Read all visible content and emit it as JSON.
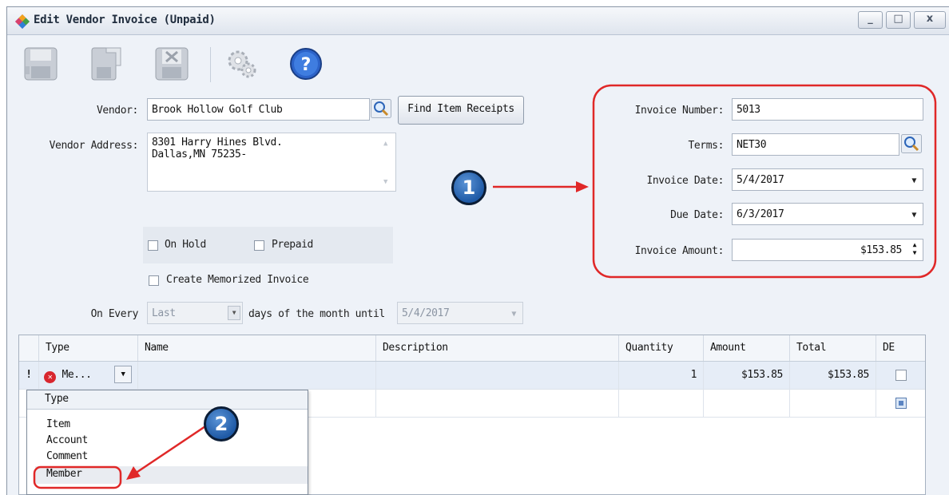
{
  "window": {
    "title": "Edit Vendor Invoice (Unpaid)",
    "minimize_glyph": "_",
    "maximize_glyph": "□",
    "close_glyph": "x"
  },
  "toolbar": {
    "buttons": [
      "save-icon",
      "save-new-icon",
      "save-close-icon",
      "settings-icon",
      "help-icon"
    ],
    "help_glyph": "?"
  },
  "vendor": {
    "label": "Vendor:",
    "value": "Brook Hollow Golf Club",
    "find_receipts_label": "Find Item Receipts",
    "address_label": "Vendor Address:",
    "address_line1": "8301 Harry Hines Blvd.",
    "address_line2": "Dallas,MN 75235-"
  },
  "flags": {
    "on_hold_label": "On Hold",
    "prepaid_label": "Prepaid",
    "memorized_label": "Create Memorized Invoice",
    "on_every_label": "On Every",
    "on_every_value": "Last",
    "days_label": "days of the month until",
    "until_value": "5/4/2017"
  },
  "invoice": {
    "number_label": "Invoice Number:",
    "number_value": "5013",
    "terms_label": "Terms:",
    "terms_value": "NET30",
    "date_label": "Invoice Date:",
    "date_value": "5/4/2017",
    "due_label": "Due Date:",
    "due_value": "6/3/2017",
    "amount_label": "Invoice Amount:",
    "amount_value": "$153.85"
  },
  "grid": {
    "columns": [
      "Type",
      "Name",
      "Description",
      "Quantity",
      "Amount",
      "Total",
      "DE"
    ],
    "rows": [
      {
        "type": "Me...",
        "name": "",
        "description": "",
        "quantity": "1",
        "amount": "$153.85",
        "total": "$153.85"
      }
    ],
    "error_marker": "!",
    "new_row_marker": "*"
  },
  "type_dropdown": {
    "header": "Type",
    "options": [
      "Item",
      "Account",
      "Comment",
      "Member"
    ],
    "selected": "Member"
  },
  "callouts": {
    "one": "1",
    "two": "2"
  },
  "colors": {
    "annotation_red": "#e02828",
    "badge_blue": "#2a67b5"
  }
}
